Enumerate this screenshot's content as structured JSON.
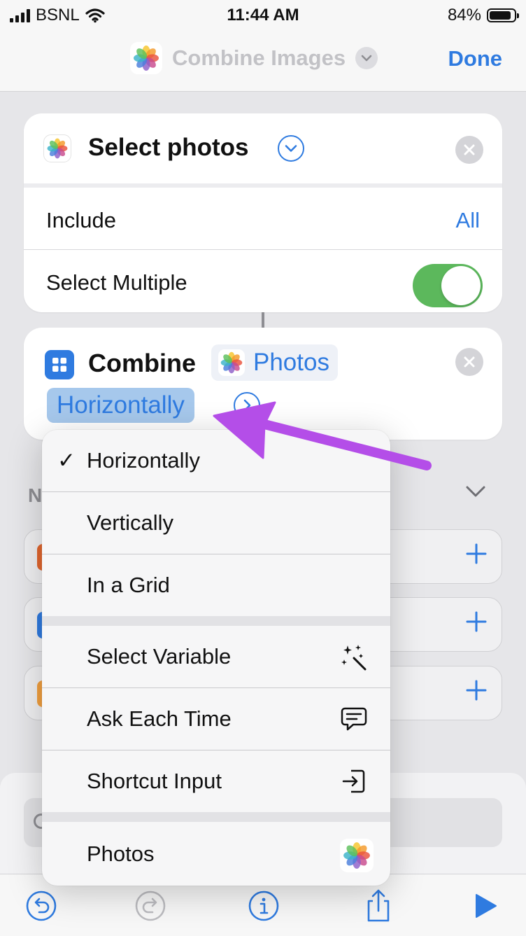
{
  "status_bar": {
    "carrier": "BSNL",
    "time": "11:44 AM",
    "battery_percent": "84%",
    "battery_level": 0.84
  },
  "nav": {
    "title": "Combine Images",
    "done_label": "Done"
  },
  "select_photos_card": {
    "title": "Select photos",
    "include_label": "Include",
    "include_value": "All",
    "select_multiple_label": "Select Multiple",
    "select_multiple_on": true
  },
  "combine_card": {
    "title": "Combine",
    "input_token": "Photos",
    "mode_token": "Horizontally"
  },
  "background": {
    "section_letter": "N"
  },
  "menu": {
    "checkmark": "✓",
    "items": [
      {
        "label": "Horizontally",
        "selected": true
      },
      {
        "label": "Vertically"
      },
      {
        "label": "In a Grid"
      },
      {
        "label": "Select Variable",
        "icon": "magic-wand-icon"
      },
      {
        "label": "Ask Each Time",
        "icon": "speech-bubble-icon"
      },
      {
        "label": "Shortcut Input",
        "icon": "input-arrow-icon"
      },
      {
        "label": "Photos",
        "icon": "photos-app-icon"
      }
    ]
  },
  "colors": {
    "accent": "#2f7be0",
    "toggle_on": "#5cb85c",
    "annotation_arrow": "#b44ee8"
  }
}
